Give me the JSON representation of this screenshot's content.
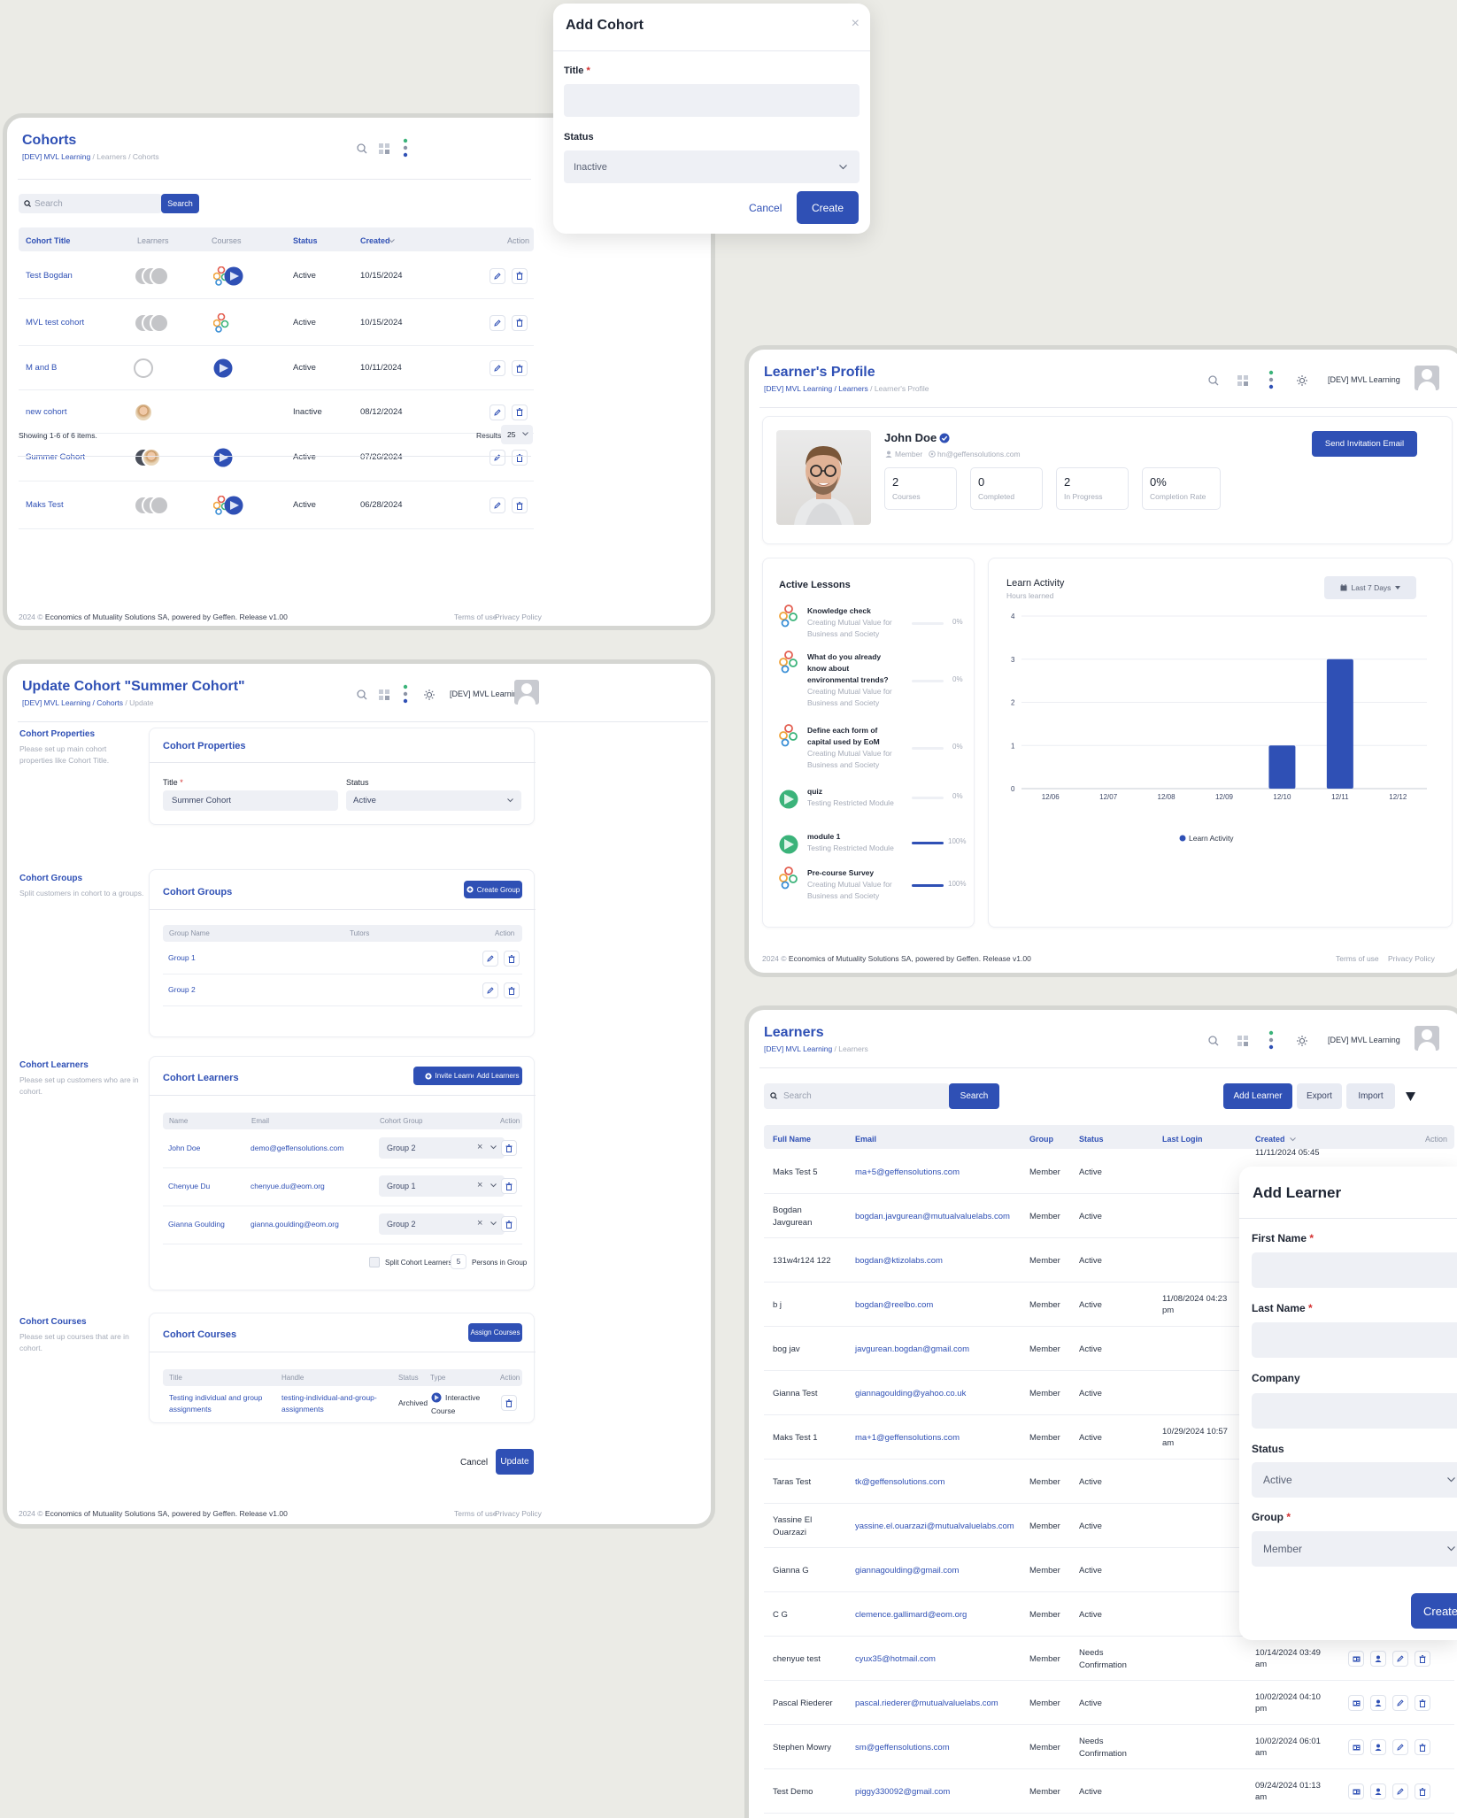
{
  "cohorts": {
    "title": "Cohorts",
    "crumb_root": "[DEV] MVL Learning",
    "crumb_rest": " / Learners / Cohorts",
    "search_placeholder": "Search",
    "search_btn": "Search",
    "cols": {
      "title": "Cohort Title",
      "learners": "Learners",
      "courses": "Courses",
      "status": "Status",
      "created": "Created",
      "action": "Action"
    },
    "rows": [
      {
        "title": "Test Bogdan",
        "status": "Active",
        "created": "10/15/2024"
      },
      {
        "title": "MVL test cohort",
        "status": "Active",
        "created": "10/15/2024"
      },
      {
        "title": "M and B",
        "status": "Active",
        "created": "10/11/2024"
      },
      {
        "title": "new cohort",
        "status": "Inactive",
        "created": "08/12/2024"
      },
      {
        "title": "Summer Cohort",
        "status": "Active",
        "created": "07/26/2024"
      },
      {
        "title": "Maks Test",
        "status": "Active",
        "created": "06/28/2024"
      }
    ],
    "showing": "Showing 1-6 of 6 items.",
    "results_label": "Results:",
    "results_value": "25",
    "footer_year": "2024 ©",
    "footer_text": "Economics of Mutuality Solutions SA, powered by Geffen. Release v1.00",
    "terms": "Terms of use",
    "privacy": "Privacy Policy"
  },
  "add_cohort": {
    "title": "Add Cohort",
    "close": "×",
    "title_label": "Title",
    "req": "*",
    "status_label": "Status",
    "status_value": "Inactive",
    "cancel": "Cancel",
    "create": "Create"
  },
  "update": {
    "title": "Update Cohort \"Summer Cohort\"",
    "crumb_root": "[DEV] MVL Learning",
    "crumb_mid": " / Cohorts",
    "crumb_rest": " / Update",
    "org": "[DEV] MVL Learning",
    "props": {
      "side_title": "Cohort Properties",
      "side_desc": "Please set up main cohort properties like Cohort Title.",
      "card_title": "Cohort Properties",
      "title_label": "Title",
      "title_value": "Summer Cohort",
      "status_label": "Status",
      "status_value": "Active"
    },
    "groups": {
      "side_title": "Cohort Groups",
      "side_desc": "Split customers in cohort to a groups.",
      "card_title": "Cohort Groups",
      "create_btn": "Create Group",
      "col_name": "Group Name",
      "col_tutors": "Tutors",
      "col_action": "Action",
      "items": [
        "Group 1",
        "Group 2"
      ]
    },
    "learners": {
      "side_title": "Cohort Learners",
      "side_desc": "Please set up customers who are in cohort.",
      "card_title": "Cohort Learners",
      "invite_btn": "Invite Learner",
      "add_btn": "Add Learners",
      "col_name": "Name",
      "col_email": "Email",
      "col_group": "Cohort Group",
      "col_action": "Action",
      "items": [
        {
          "name": "John Doe",
          "email": "demo@geffensolutions.com",
          "group": "Group 2"
        },
        {
          "name": "Chenyue Du",
          "email": "chenyue.du@eom.org",
          "group": "Group 1"
        },
        {
          "name": "Gianna Goulding",
          "email": "gianna.goulding@eom.org",
          "group": "Group 2"
        }
      ],
      "split_label": "Split Cohort Learners by",
      "split_value": "5",
      "split_suffix": "Persons in Group"
    },
    "courses": {
      "side_title": "Cohort Courses",
      "side_desc": "Please set up courses that are in cohort.",
      "card_title": "Cohort Courses",
      "assign_btn": "Assign Courses",
      "col_title": "Title",
      "col_handle": "Handle",
      "col_status": "Status",
      "col_type": "Type",
      "col_action": "Action",
      "item": {
        "title1": "Testing individual and group",
        "title2": "assignments",
        "handle1": "testing-individual-and-group-",
        "handle2": "assignments",
        "status": "Archived",
        "type1": "Interactive",
        "type2": "Course"
      }
    },
    "cancel": "Cancel",
    "update_btn": "Update"
  },
  "profile": {
    "title": "Learner's Profile",
    "crumb_root": "[DEV] MVL Learning",
    "crumb_mid": " / Learners",
    "crumb_rest": " / Learner's Profile",
    "org": "[DEV] MVL Learning",
    "name": "John Doe",
    "role": "Member",
    "email": "hn@geffensolutions.com",
    "send_btn": "Send Invitation Email",
    "stats": [
      {
        "n": "2",
        "t": "Courses"
      },
      {
        "n": "0",
        "t": "Completed"
      },
      {
        "n": "2",
        "t": "In Progress"
      },
      {
        "n": "0%",
        "t": "Completion Rate"
      }
    ],
    "lessons_title": "Active Lessons",
    "lessons": [
      {
        "l1": "Knowledge check",
        "l2": "",
        "l3": "",
        "c1": "Creating Mutual Value for",
        "c2": "Business and Society",
        "pct": "0%",
        "progress": 0
      },
      {
        "l1": "What do you already",
        "l2": "know about",
        "l3": "environmental trends?",
        "c1": "Creating Mutual Value for",
        "c2": "Business and Society",
        "pct": "0%",
        "progress": 0
      },
      {
        "l1": "Define each form of",
        "l2": "capital used by EoM",
        "l3": "",
        "c1": "Creating Mutual Value for",
        "c2": "Business and Society",
        "pct": "0%",
        "progress": 0
      },
      {
        "l1": "quiz",
        "l2": "",
        "l3": "",
        "c1": "Testing Restricted Module",
        "c2": "",
        "pct": "0%",
        "progress": 0
      },
      {
        "l1": "module 1",
        "l2": "",
        "l3": "",
        "c1": "Testing Restricted Module",
        "c2": "",
        "pct": "100%",
        "progress": 100
      },
      {
        "l1": "Pre-course Survey",
        "l2": "",
        "l3": "",
        "c1": "Creating Mutual Value for",
        "c2": "Business and Society",
        "pct": "100%",
        "progress": 100
      }
    ],
    "activity_title": "Learn Activity",
    "activity_sub": "Hours learned",
    "range_btn": "Last 7 Days",
    "footer_year": "2024 ©",
    "footer_text": "Economics of Mutuality Solutions SA, powered by Geffen. Release v1.00",
    "terms": "Terms of use",
    "privacy": "Privacy Policy"
  },
  "chart_data": {
    "type": "bar",
    "categories": [
      "12/06",
      "12/07",
      "12/08",
      "12/09",
      "12/10",
      "12/11",
      "12/12"
    ],
    "values": [
      0,
      0,
      0,
      0,
      1,
      3,
      0
    ],
    "ylim": [
      0,
      4
    ],
    "yticks": [
      "0",
      "1",
      "2",
      "3",
      "4"
    ],
    "series_name": "Learn Activity",
    "legend": "bottom",
    "color": "#2f50b5"
  },
  "learners": {
    "title": "Learners",
    "crumb_root": "[DEV] MVL Learning",
    "crumb_rest": " / Learners",
    "org": "[DEV] MVL Learning",
    "search_placeholder": "Search",
    "search_btn": "Search",
    "add_btn": "Add Learner",
    "export_btn": "Export",
    "import_btn": "Import",
    "cols": {
      "name": "Full Name",
      "email": "Email",
      "group": "Group",
      "status": "Status",
      "login": "Last Login",
      "created": "Created",
      "action": "Action"
    },
    "rows": [
      {
        "n1": "Maks Test 5",
        "n2": "",
        "email": "ma+5@geffensolutions.com",
        "group": "Member",
        "s1": "Active",
        "s2": "",
        "login1": "",
        "login2": "",
        "c1": "11/11/2024 05:45",
        "c2": ""
      },
      {
        "n1": "Bogdan",
        "n2": "Javgurean",
        "email": "bogdan.javgurean@mutualvaluelabs.com",
        "group": "Member",
        "s1": "Active",
        "s2": "",
        "login1": "",
        "login2": "",
        "c1": "",
        "c2": ""
      },
      {
        "n1": "131w4r124 122",
        "n2": "",
        "email": "bogdan@ktizolabs.com",
        "group": "Member",
        "s1": "Active",
        "s2": "",
        "login1": "",
        "login2": "",
        "c1": "",
        "c2": ""
      },
      {
        "n1": "b j",
        "n2": "",
        "email": "bogdan@reelbo.com",
        "group": "Member",
        "s1": "Active",
        "s2": "",
        "login1": "11/08/2024 04:23",
        "login2": "pm",
        "c1": "",
        "c2": ""
      },
      {
        "n1": "bog jav",
        "n2": "",
        "email": "javgurean.bogdan@gmail.com",
        "group": "Member",
        "s1": "Active",
        "s2": "",
        "login1": "",
        "login2": "",
        "c1": "",
        "c2": ""
      },
      {
        "n1": "Gianna Test",
        "n2": "",
        "email": "giannagoulding@yahoo.co.uk",
        "group": "Member",
        "s1": "Active",
        "s2": "",
        "login1": "",
        "login2": "",
        "c1": "",
        "c2": ""
      },
      {
        "n1": "Maks Test 1",
        "n2": "",
        "email": "ma+1@geffensolutions.com",
        "group": "Member",
        "s1": "Active",
        "s2": "",
        "login1": "10/29/2024 10:57",
        "login2": "am",
        "c1": "",
        "c2": ""
      },
      {
        "n1": "Taras Test",
        "n2": "",
        "email": "tk@geffensolutions.com",
        "group": "Member",
        "s1": "Active",
        "s2": "",
        "login1": "",
        "login2": "",
        "c1": "",
        "c2": ""
      },
      {
        "n1": "Yassine El",
        "n2": "Ouarzazi",
        "email": "yassine.el.ouarzazi@mutualvaluelabs.com",
        "group": "Member",
        "s1": "Active",
        "s2": "",
        "login1": "",
        "login2": "",
        "c1": "",
        "c2": ""
      },
      {
        "n1": "Gianna G",
        "n2": "",
        "email": "giannagoulding@gmail.com",
        "group": "Member",
        "s1": "Active",
        "s2": "",
        "login1": "",
        "login2": "",
        "c1": "",
        "c2": ""
      },
      {
        "n1": "C G",
        "n2": "",
        "email": "clemence.gallimard@eom.org",
        "group": "Member",
        "s1": "Active",
        "s2": "",
        "login1": "",
        "login2": "",
        "c1": "",
        "c2": ""
      },
      {
        "n1": "chenyue test",
        "n2": "",
        "email": "cyux35@hotmail.com",
        "group": "Member",
        "s1": "Needs",
        "s2": "Confirmation",
        "login1": "",
        "login2": "",
        "c1": "10/14/2024 03:49",
        "c2": "am"
      },
      {
        "n1": "Pascal Riederer",
        "n2": "",
        "email": "pascal.riederer@mutualvaluelabs.com",
        "group": "Member",
        "s1": "Active",
        "s2": "",
        "login1": "",
        "login2": "",
        "c1": "10/02/2024 04:10",
        "c2": "pm"
      },
      {
        "n1": "Stephen Mowry",
        "n2": "",
        "email": "sm@geffensolutions.com",
        "group": "Member",
        "s1": "Needs",
        "s2": "Confirmation",
        "login1": "",
        "login2": "",
        "c1": "10/02/2024 06:01",
        "c2": "am"
      },
      {
        "n1": "Test Demo",
        "n2": "",
        "email": "piggy330092@gmail.com",
        "group": "Member",
        "s1": "Active",
        "s2": "",
        "login1": "",
        "login2": "",
        "c1": "09/24/2024 01:13",
        "c2": "am"
      }
    ]
  },
  "add_learner": {
    "title": "Add Learner",
    "first_label": "First Name",
    "last_label": "Last Name",
    "company_label": "Company",
    "status_label": "Status",
    "status_value": "Active",
    "group_label": "Group",
    "group_value": "Member",
    "req": "*",
    "create": "Create"
  },
  "colors": {
    "primary": "#2f50b5",
    "bg": "#ebebe6",
    "input": "#eef0f5"
  }
}
